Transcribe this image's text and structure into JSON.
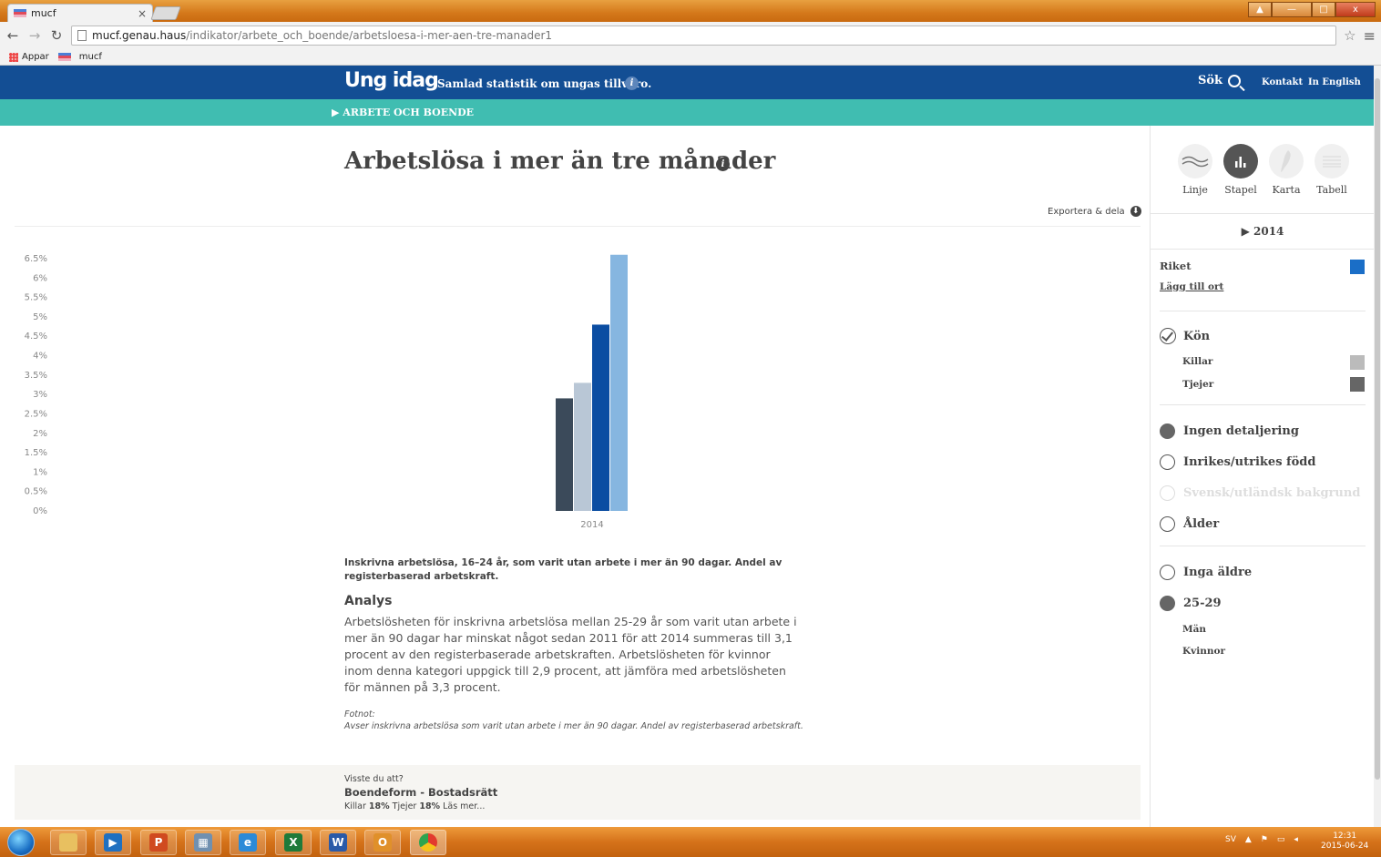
{
  "browser": {
    "tab_title": "mucf",
    "tab_close": "×",
    "url_host": "mucf.genau.haus",
    "url_path": "/indikator/arbete_och_boende/arbetsloesa-i-mer-aen-tre-manader1",
    "bookmarks": [
      "Appar",
      "mucf"
    ],
    "window_buttons": [
      "▲",
      "—",
      "□",
      "x"
    ]
  },
  "header": {
    "logo": "Ung idag",
    "tagline": "Samlad statistik om ungas tillvaro.",
    "search_label": "Sök",
    "contact": "Kontakt",
    "english": "In English",
    "subnav": "▶ ARBETE OCH BOENDE"
  },
  "main": {
    "title": "Arbetslösa i mer än tre månader",
    "export_label": "Exportera & dela",
    "caption": "Inskrivna arbetslösa, 16–24 år, som varit utan arbete i mer än 90 dagar. Andel av registerbaserad arbetskraft.",
    "analysis_title": "Analys",
    "analysis_text": "Arbetslösheten för inskrivna arbetslösa mellan 25-29 år som varit utan arbete i mer än 90 dagar har minskat något sedan 2011 för att 2014 summeras till 3,1 procent av den registerbaserade arbetskraften. Arbetslösheten för kvinnor inom denna kategori uppgick till 2,9 procent, att jämföra med arbetslösheten för männen på 3,3 procent.",
    "footnote_label": "Fotnot:",
    "footnote_text": "Avser inskrivna arbetslösa som varit utan arbete i mer än 90 dagar. Andel av registerbaserad arbetskraft."
  },
  "did_you_know": {
    "question": "Visste du att?",
    "title": "Boendeform - Bostadsrätt",
    "killar_label": "Killar",
    "killar_value": "18%",
    "tjejer_label": "Tjejer",
    "tjejer_value": "18%",
    "more": "Läs mer..."
  },
  "sidebar": {
    "views": [
      {
        "label": "Linje",
        "icon": "line-chart-icon",
        "active": false
      },
      {
        "label": "Stapel",
        "icon": "bar-chart-icon",
        "active": true
      },
      {
        "label": "Karta",
        "icon": "map-icon",
        "active": false
      },
      {
        "label": "Tabell",
        "icon": "table-icon",
        "active": false
      }
    ],
    "year": "▶ 2014",
    "region": "Riket",
    "add_place": "Lägg till ort",
    "gender_heading": "Kön",
    "killar": "Killar",
    "tjejer": "Tjejer",
    "detail_options": [
      "Ingen detaljering",
      "Inrikes/utrikes född",
      "Svensk/utländsk bakgrund",
      "Ålder"
    ],
    "age_options": [
      "Inga äldre",
      "25-29"
    ],
    "age_sub": [
      "Män",
      "Kvinnor"
    ],
    "colors": {
      "riket": "#1a6ec7",
      "killar": "#bbbbbb",
      "tjejer": "#666666"
    }
  },
  "chart_data": {
    "type": "bar",
    "categories": [
      "2014"
    ],
    "series": [
      {
        "values": [
          2.9
        ],
        "color": "#3b4a5a"
      },
      {
        "values": [
          3.3
        ],
        "color": "#b9c7d6"
      },
      {
        "values": [
          4.8
        ],
        "color": "#0b4da2"
      },
      {
        "values": [
          6.6
        ],
        "color": "#86b6e0"
      }
    ],
    "ylim": [
      0,
      6.5
    ],
    "yticks": [
      "0%",
      "0.5%",
      "1%",
      "1.5%",
      "2%",
      "2.5%",
      "3%",
      "3.5%",
      "4%",
      "4.5%",
      "5%",
      "5.5%",
      "6%",
      "6.5%"
    ],
    "ytick_values": [
      0,
      0.5,
      1,
      1.5,
      2,
      2.5,
      3,
      3.5,
      4,
      4.5,
      5,
      5.5,
      6,
      6.5
    ],
    "grid": false
  },
  "taskbar": {
    "lang": "SV",
    "time": "12:31",
    "date": "2015-06-24"
  }
}
